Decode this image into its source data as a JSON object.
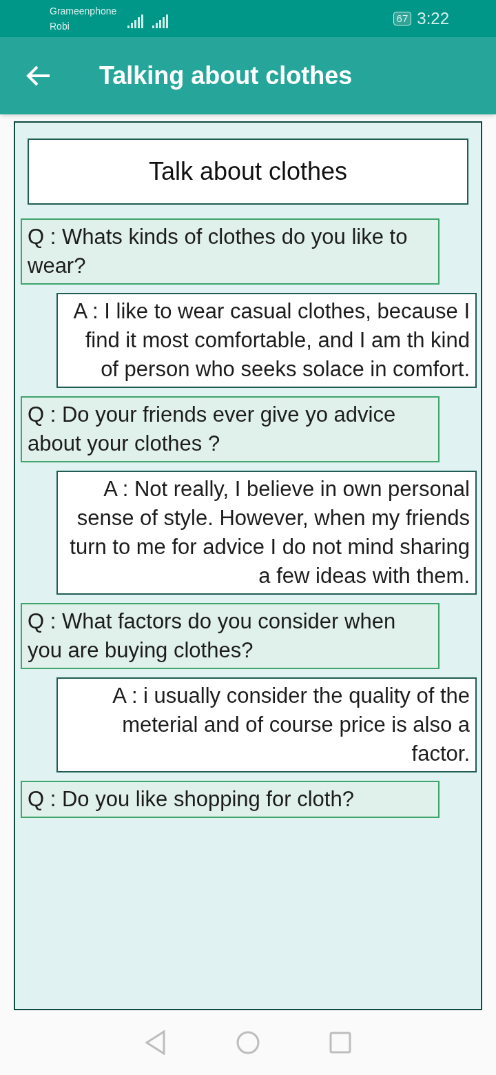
{
  "status_bar": {
    "carriers": [
      "Grameenphone",
      "Robi"
    ],
    "battery": "67",
    "time": "3:22"
  },
  "app_bar": {
    "title": "Talking about clothes"
  },
  "heading": "Talk about clothes",
  "items": [
    {
      "kind": "question",
      "text": "Q : Whats kinds of clothes do you like to wear?"
    },
    {
      "kind": "answer",
      "text": "A : I like to wear casual clothes, because I find it most comfortable, and I am th kind of person who seeks solace in comfort."
    },
    {
      "kind": "question",
      "text": "Q : Do your friends ever give yo advice about your clothes ?"
    },
    {
      "kind": "answer",
      "text": "A : Not really, I believe in own personal sense of style. However, when my friends turn to me for advice I do not mind sharing a few ideas with them."
    },
    {
      "kind": "question",
      "text": "Q : What factors do you consider when you are buying clothes?"
    },
    {
      "kind": "answer",
      "text": "A : i usually consider the quality of the meterial and of course price is also a factor."
    },
    {
      "kind": "question",
      "text": "Q : Do you like shopping for cloth?"
    }
  ]
}
